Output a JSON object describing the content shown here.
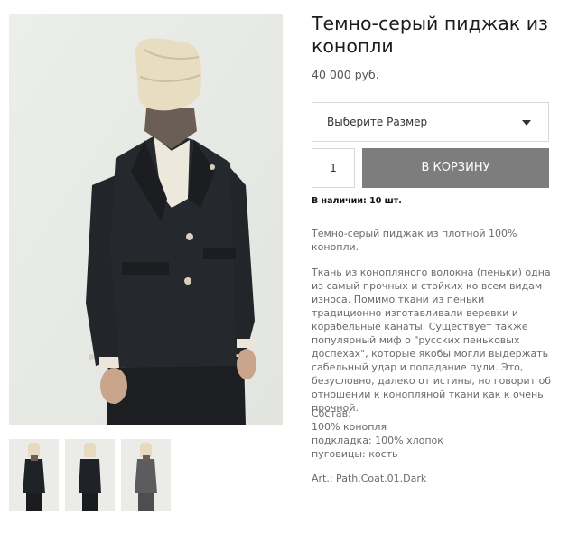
{
  "product": {
    "title": "Темно-серый пиджак из конопли",
    "price": "40 000 руб."
  },
  "size_select": {
    "placeholder": "Выберите Размер",
    "icon": "caret-down-icon"
  },
  "quantity": {
    "value": "1"
  },
  "cart_button": {
    "label": "В КОРЗИНУ"
  },
  "stock": {
    "text": "В наличии: 10 шт."
  },
  "description": {
    "intro": "Темно-серый пиджак из плотной 100% конопли.",
    "body": "Ткань из конопляного волокна (пеньки) одна из самый прочных и стойких ко всем видам износа. Помимо ткани из пеньки традиционно изготавливали веревки и корабельные канаты. Существует также популярный миф о \"русских пеньковых доспехах\", которые якобы могли выдержать сабельный удар и попадание пули. Это, безусловно, далеко от истины, но говорит об отношении к конопляной ткани как к очень прочной.",
    "composition": {
      "heading": "Состав:",
      "lines": [
        "100% конопля",
        "подкладка: 100% хлопок",
        "пуговицы: кость"
      ]
    },
    "article": "Art.: Path.Coat.01.Dark"
  },
  "gallery": {
    "main_image": "model-dark-jacket-photo",
    "thumbnails": [
      {
        "name": "front-view",
        "jacket_color": "#1f2226"
      },
      {
        "name": "back-view",
        "jacket_color": "#1f2226"
      },
      {
        "name": "front-view-grey",
        "jacket_color": "#5a5c5e"
      }
    ]
  }
}
